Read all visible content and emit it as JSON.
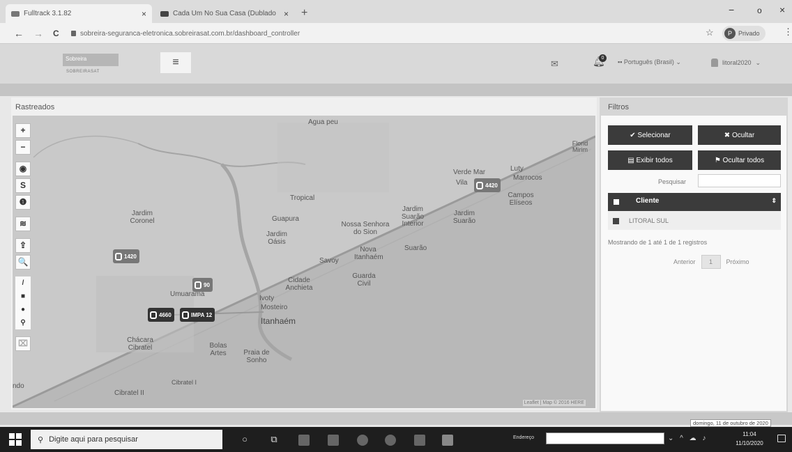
{
  "browser": {
    "tabs": [
      {
        "title": "Fulltrack 3.1.82",
        "active": true
      },
      {
        "title": "Cada Um No Sua Casa (Dublado",
        "active": false
      }
    ],
    "new_tab": "+",
    "win_min": "−",
    "win_restore": "o",
    "win_close": "×",
    "nav_back": "←",
    "nav_forward": "→",
    "nav_reload": "C",
    "url": "sobreira-seguranca-eletronica.sobreirasat.com.br/dashboard_controller",
    "profile_label": "Privado",
    "profile_initial": "P"
  },
  "app": {
    "logo_text": "Sobreira",
    "logo_sub": "SOBREIRASAT",
    "menu_icon": "≡",
    "bell_count": "0",
    "language": "Português (Brasil)",
    "user": "litoral2020"
  },
  "map_panel": {
    "title": "Rastreados",
    "tools": [
      "+",
      "−",
      "◉",
      "S",
      "❶",
      "≋",
      "⇪",
      "🔍"
    ],
    "draw_tools": [
      "/",
      "■",
      "●",
      "⚲"
    ],
    "attribution": "Leaflet | Map © 2016 HERE",
    "labels": [
      {
        "text": "Agua peu",
        "style": ""
      },
      {
        "text": "Florid Mirim",
        "style": ""
      },
      {
        "text": "Verde Mar",
        "style": ""
      },
      {
        "text": "Luty",
        "style": ""
      },
      {
        "text": "Vila",
        "style": ""
      },
      {
        "text": "Marrocos",
        "style": ""
      },
      {
        "text": "Campos Elíseos",
        "style": ""
      },
      {
        "text": "Tropical",
        "style": ""
      },
      {
        "text": "Jardim Coronel",
        "style": ""
      },
      {
        "text": "Guapura",
        "style": ""
      },
      {
        "text": "Jardim Suarão Interior",
        "style": ""
      },
      {
        "text": "Jardim Suarão",
        "style": ""
      },
      {
        "text": "Nossa Senhora do Sion",
        "style": ""
      },
      {
        "text": "Jardim Oásis",
        "style": ""
      },
      {
        "text": "Suarão",
        "style": ""
      },
      {
        "text": "Nova Itanhaém",
        "style": ""
      },
      {
        "text": "Savoy",
        "style": ""
      },
      {
        "text": "Guarda Civil",
        "style": ""
      },
      {
        "text": "Cidade Anchieta",
        "style": ""
      },
      {
        "text": "Umuarama",
        "style": ""
      },
      {
        "text": "Ivoty",
        "style": ""
      },
      {
        "text": "Mosteiro",
        "style": ""
      },
      {
        "text": "Itanhaém",
        "style": "big"
      },
      {
        "text": "Chácara Cibratel",
        "style": ""
      },
      {
        "text": "Bolas Artes",
        "style": ""
      },
      {
        "text": "Praia de Sonho",
        "style": ""
      },
      {
        "text": "Cibratel I",
        "style": ""
      },
      {
        "text": "Cibratel II",
        "style": ""
      },
      {
        "text": "ndo",
        "style": ""
      }
    ],
    "markers": [
      {
        "label": "4420",
        "style": "light"
      },
      {
        "label": "1420",
        "style": "light"
      },
      {
        "label": "90",
        "style": "light"
      },
      {
        "label": "4660",
        "style": "dark"
      },
      {
        "label": "IMPA 12",
        "style": "dark"
      }
    ]
  },
  "filter_panel": {
    "title": "Filtros",
    "btn_select": "✔ Selecionar",
    "btn_hide": "✖ Ocultar",
    "btn_show_all": "▤ Exibir todos",
    "btn_hide_all": "⚑ Ocultar todos",
    "search_label": "Pesquisar",
    "search_value": "",
    "col_header": "Cliente",
    "sort_icon": "⇕",
    "rows": [
      {
        "client": "LITORAL SUL"
      }
    ],
    "info": "Mostrando de 1 até 1 de 1 registros",
    "prev": "Anterior",
    "page": "1",
    "next": "Próximo"
  },
  "tooltip": "domingo, 11 de outubro de 2020",
  "taskbar": {
    "search_placeholder": "Digite aqui para pesquisar",
    "address_label": "Endereço",
    "time": "11:04",
    "date": "11/10/2020",
    "tray": "⌄ ^ ☁ ♪"
  }
}
